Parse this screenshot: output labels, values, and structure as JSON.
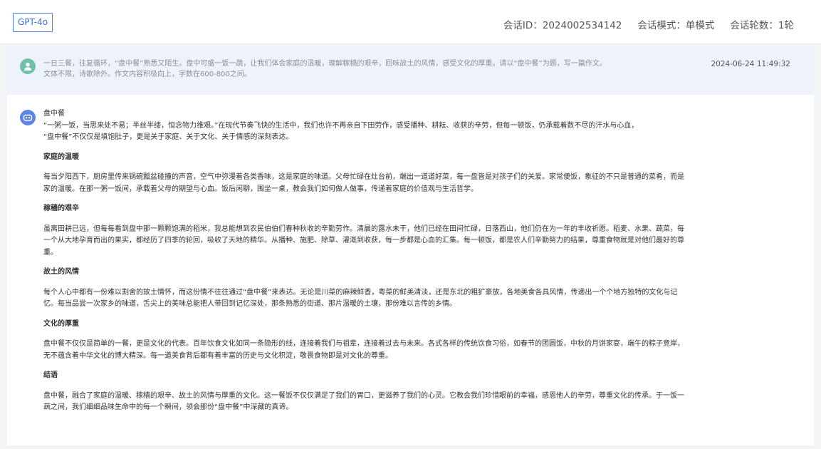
{
  "header": {
    "model": "GPT-4o",
    "session_id_label": "会话ID：",
    "session_id": "2024002534142",
    "mode_label": "会话模式：",
    "mode": "单模式",
    "rounds_label": "会话轮数：",
    "rounds": "1轮"
  },
  "user_message": {
    "line1": "一日三餐，往复循环，“盘中餐”熟悉又陌生。盘中可盛一饭一蔬，让我们体会家庭的温暖，理解稼穑的艰辛，回味故土的风情，感受文化的厚重。请以“盘中餐”为题，写一篇作文。",
    "line2": "文体不限，诗歌除外。作文内容积极向上，字数在600-800之间。",
    "time": "2024-06-24 11:49:32"
  },
  "answer": {
    "title": "盘中餐",
    "intro1": "“一粥一饭，当思来处不易；半丝半缕，恒念物力维艰。”在现代节奏飞快的生活中，我们也许不再亲自下田劳作，感受播种、耕耘、收获的辛劳，但每一顿饭，仍承载着数不尽的汗水与心血，",
    "intro2": "“盘中餐”不仅仅是填饱肚子，更是关于家庭、关于文化、关于情感的深刻表达。",
    "h1": "家庭的温暖",
    "p1": "每当夕阳西下，厨房里传来锅碗瓢盆碰撞的声音，空气中弥漫着各类香味，这是家庭的味道。父母忙碌在灶台前，端出一道道好菜，每一盘皆是对孩子们的关爱。家常便饭，象征的不只是普通的菜肴，而是家的温暖。在那一粥一饭间，承载着父母的期望与心血。饭后闲聊，围坐一桌，教会我们如何做人做事，传递着家庭的价值观与生活哲学。",
    "h2": "稼穑的艰辛",
    "p2": "虽离田耕已远，但每每看到盘中那一颗颗饱满的稻米，我总能想到农民伯伯们春种秋收的辛勤劳作。清晨的露水未干，他们已经在田间忙碌，日落西山，他们仍在为一年的丰收祈愿。稻麦、水果、蔬菜，每一个从大地孕育而出的果实，都经历了四季的轮回，吸收了天地的精华。从播种、施肥、除草、灌溉到收获，每一步都是心血的汇集。每一顿饭，都是农人们辛勤努力的结果，尊重食物就是对他们最好的尊重。",
    "h3": "故土的风情",
    "p3": "每个人心中都有一份难以割舍的故土情怀，而这份情不往往通过“盘中餐”来表达。无论是川菜的麻辣鲜香，粤菜的鲜美清淡，还是东北的粗犷豪放，各地美食各具风情，传递出一个个地方独特的文化与记忆。每当品尝一次家乡的味道，舌尖上的美味总能把人带回到记忆深处，那条熟悉的街道、那片温暖的土壤，那份难以言传的乡情。",
    "h4": "文化的厚重",
    "p4": "盘中餐不仅仅是简单的一餐，更是文化的代表。百年饮食文化如同一条隐形的线，连接着我们与祖辈，连接着过去与未来。各式各样的传统饮食习俗，如春节的团圆饭，中秋的月饼家宴，端午的粽子竞岸，无不蕴含着中华文化的博大精深。每一道美食背后都有着丰富的历史与文化积淀，敬畏食物即是对文化的尊重。",
    "h5": "结语",
    "p5": "盘中餐，融合了家庭的温暖、稼穑的艰辛、故土的风情与厚重的文化。这一餐饭不仅仅满足了我们的胃口，更滋养了我们的心灵。它教会我们珍惜眼前的幸福，感恩他人的辛劳，尊重文化的传承。于一饭一蔬之间，我们细细品味生命中的每一个瞬间，领会那份“盘中餐”中深藏的真谛。"
  },
  "colors": {
    "accent": "#4a7cf7",
    "user_bg": "#eef3fb",
    "user_avatar": "#6fc2a8",
    "bot_avatar": "#5b86e5"
  }
}
